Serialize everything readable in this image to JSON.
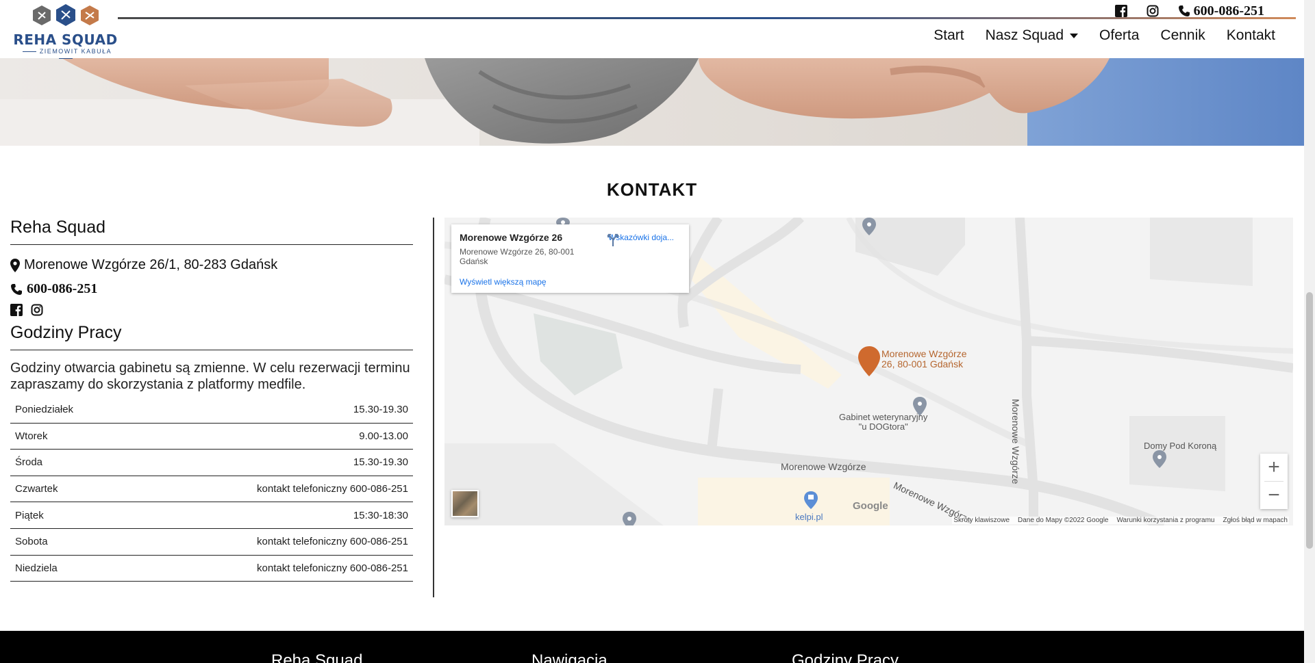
{
  "brand": {
    "name": "REHA SQUAD",
    "subtitle": "ZIEMOWIT KABUŁA"
  },
  "top_bar": {
    "phone": "600-086-251",
    "facebook_icon": "facebook-icon",
    "instagram_icon": "instagram-icon"
  },
  "nav": {
    "items": [
      {
        "label": "Start"
      },
      {
        "label": "Nasz Squad"
      },
      {
        "label": "Oferta"
      },
      {
        "label": "Cennik"
      },
      {
        "label": "Kontakt"
      }
    ]
  },
  "contact": {
    "section_title": "KONTAKT",
    "company": "Reha Squad",
    "address": "Morenowe Wzgórze 26/1, 80-283 Gdańsk",
    "phone": "600-086-251"
  },
  "hours": {
    "title": "Godziny Pracy",
    "description": "Godziny otwarcia gabinetu są zmienne. W celu rezerwacji terminu zapraszamy do skorzystania z platformy medfile.",
    "rows": [
      {
        "day": "Poniedziałek",
        "time": "15.30-19.30"
      },
      {
        "day": "Wtorek",
        "time": "9.00-13.00"
      },
      {
        "day": "Środa",
        "time": "15.30-19.30"
      },
      {
        "day": "Czwartek",
        "time": "kontakt telefoniczny 600-086-251"
      },
      {
        "day": "Piątek",
        "time": "15:30-18:30"
      },
      {
        "day": "Sobota",
        "time": "kontakt telefoniczny 600-086-251"
      },
      {
        "day": "Niedziela",
        "time": "kontakt telefoniczny 600-086-251"
      }
    ]
  },
  "map": {
    "card_title": "Morenowe Wzgórze 26",
    "card_address": "Morenowe Wzgórze 26, 80-001 Gdańsk",
    "directions": "Wskazówki doja...",
    "larger_map": "Wyświetl większą mapę",
    "marker_label_1": "Morenowe Wzgórze",
    "marker_label_2": "26, 80-001 Gdańsk",
    "poi_vet_1": "Gabinet weterynaryjny",
    "poi_vet_2": "\"u DOGtora\"",
    "poi_domy": "Domy Pod Koroną",
    "poi_kelpi": "kelpi.pl",
    "street_1": "Morenowe Wzgórze",
    "street_2": "Morenowe Wzgórze",
    "street_3": "Morenowe Wzgórze",
    "google": "Google",
    "footer": {
      "shortcuts": "Skróty klawiszowe",
      "data": "Dane do Mapy ©2022 Google",
      "terms": "Warunki korzystania z programu",
      "report": "Zgłoś błąd w mapach"
    }
  },
  "footer": {
    "col1": "Reha Squad",
    "col2": "Nawigacja",
    "col3": "Godziny Pracy"
  },
  "colors": {
    "brand_blue": "#2a4f8a",
    "accent_orange": "#d08a5a",
    "marker": "#cf6a2e",
    "footer_bg": "#000000"
  }
}
